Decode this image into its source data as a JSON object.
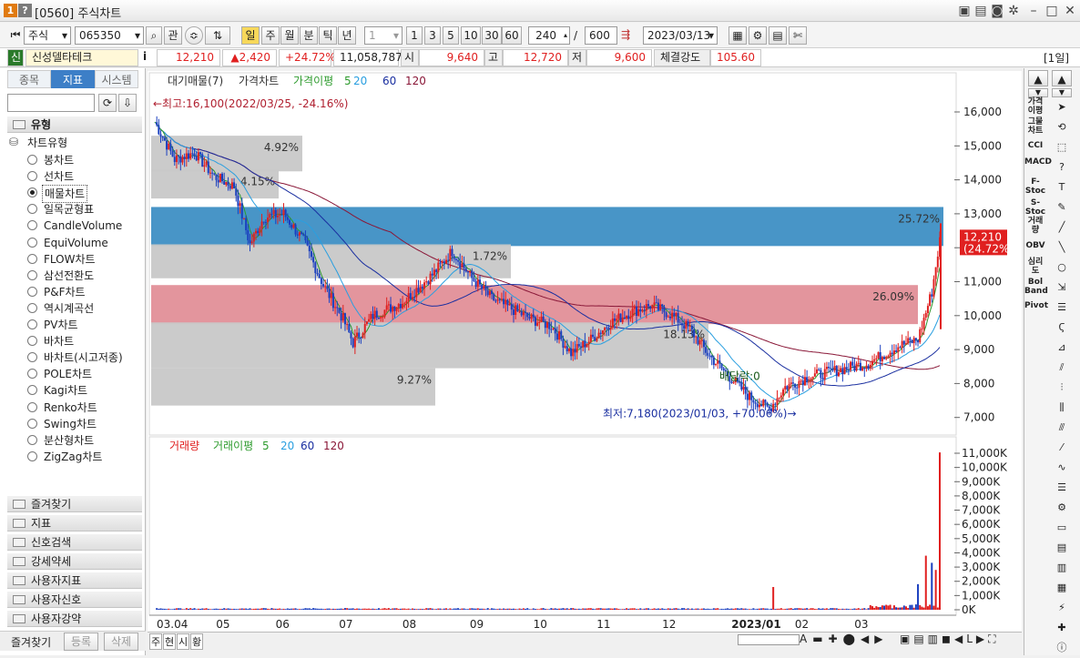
{
  "titlebar": {
    "title": "[0560] 주식차트",
    "icon1": "1",
    "icon2": "?"
  },
  "toolbar": {
    "market": "주식",
    "code": "065350",
    "btn_search": "관",
    "periods": [
      "일",
      "주",
      "월",
      "분",
      "틱",
      "년"
    ],
    "interval": "1",
    "quick": [
      "1",
      "3",
      "5",
      "10",
      "30",
      "60"
    ],
    "count": "240",
    "total": "600",
    "date": "2023/03/13"
  },
  "info": {
    "name": "신성델타테크",
    "price": "12,210",
    "change": "▲2,420",
    "pct": "+24.72%",
    "volume": "11,058,787",
    "open_l": "시",
    "open": "9,640",
    "high_l": "고",
    "high": "12,720",
    "low_l": "저",
    "low": "9,600",
    "strength_l": "체결강도",
    "strength": "105.60",
    "period": "[1일]"
  },
  "left": {
    "tabs": [
      "종목",
      "지표",
      "시스템"
    ],
    "header": "유형",
    "group": "차트유형",
    "types": [
      "봉차트",
      "선차트",
      "매물차트",
      "일목균형표",
      "CandleVolume",
      "EquiVolume",
      "FLOW차트",
      "삼선전환도",
      "P&F차트",
      "역시계곡선",
      "PV차트",
      "바차트",
      "바차트(시고저종)",
      "POLE차트",
      "Kagi차트",
      "Renko차트",
      "Swing차트",
      "분산형차트",
      "ZigZag차트"
    ],
    "selected": 2,
    "sections": [
      "즐겨찾기",
      "지표",
      "신호검색",
      "강세약세",
      "사용자지표",
      "사용자신호",
      "사용자강약"
    ],
    "bottom": [
      "즐겨찾기",
      "등록",
      "삭제"
    ]
  },
  "chart": {
    "legend_top": {
      "items": [
        "대기매물(7)",
        "가격차트",
        "가격이평",
        "5",
        "20",
        "60",
        "120"
      ]
    },
    "legend_bottom": {
      "items": [
        "거래량",
        "거래이평",
        "5",
        "20",
        "60",
        "120"
      ]
    },
    "high_note": "←최고:16,100(2022/03/25, -24.16%)",
    "low_note": "최저:7,180(2023/01/03, +70.06%)→",
    "div_note": "배당락:0",
    "price_label": "12,210",
    "price_pct": "(24.72%)",
    "y_ticks": [
      "16,000",
      "15,000",
      "14,000",
      "13,000",
      "12,000",
      "11,000",
      "10,000",
      "9,000",
      "8,000",
      "7,000"
    ],
    "vol_ticks": [
      "11,000K",
      "10,000K",
      "9,000K",
      "8,000K",
      "7,000K",
      "6,000K",
      "5,000K",
      "4,000K",
      "3,000K",
      "2,000K",
      "1,000K",
      "0K"
    ],
    "x_ticks": [
      "03.04",
      "05",
      "06",
      "07",
      "08",
      "09",
      "10",
      "11",
      "12",
      "2023/01",
      "02",
      "03"
    ],
    "bands": [
      {
        "pct": "4.92%",
        "color": "#c8c8c8"
      },
      {
        "pct": "4.15%",
        "color": "#c8c8c8"
      },
      {
        "pct": "25.72%",
        "color": "#3e8fc4"
      },
      {
        "pct": "1.72%",
        "color": "#c8c8c8"
      },
      {
        "pct": "26.09%",
        "color": "#e28f98"
      },
      {
        "pct": "18.13%",
        "color": "#c8c8c8"
      },
      {
        "pct": "9.27%",
        "color": "#c8c8c8"
      }
    ],
    "colors": {
      "up": "#e02020",
      "down": "#1a3fbf",
      "ma5": "#2e9b2e",
      "ma20": "#2a9fe0",
      "ma60": "#1a2fa0",
      "ma120": "#8a1838"
    }
  },
  "bottom_tabs": [
    "주",
    "현",
    "시",
    "황"
  ],
  "right_labels": [
    "가격이평",
    "그물차트",
    "CCI",
    "MACD",
    "F-Stoc",
    "S-Stoc",
    "거래량",
    "OBV",
    "심리도",
    "Bol Band",
    "Pivot"
  ]
}
